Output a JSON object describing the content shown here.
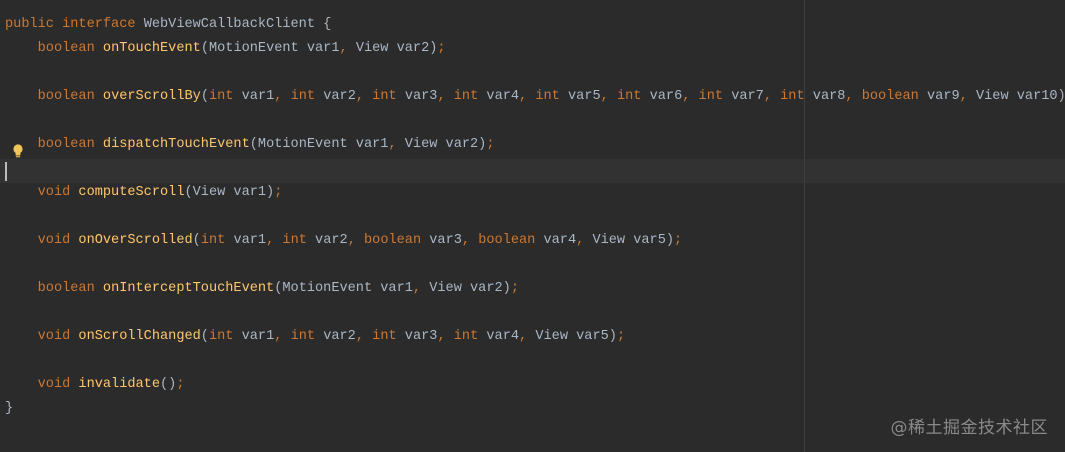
{
  "editor": {
    "language": "Java",
    "colors": {
      "background": "#2b2b2b",
      "keyword": "#cc7832",
      "method": "#ffc66d",
      "plain_text": "#a9b7c6",
      "current_line": "#323232"
    },
    "gutter_icon": "intention-bulb-icon",
    "lines": [
      [
        {
          "t": "public interface ",
          "c": "kw"
        },
        {
          "t": "WebViewCallbackClient {",
          "c": "plain"
        }
      ],
      [
        {
          "t": "    boolean ",
          "c": "kw"
        },
        {
          "t": "onTouchEvent",
          "c": "fn"
        },
        {
          "t": "(MotionEvent var1",
          "c": "plain"
        },
        {
          "t": ", ",
          "c": "punc"
        },
        {
          "t": "View var2)",
          "c": "plain"
        },
        {
          "t": ";",
          "c": "punc"
        }
      ],
      [],
      [
        {
          "t": "    boolean ",
          "c": "kw"
        },
        {
          "t": "overScrollBy",
          "c": "fn"
        },
        {
          "t": "(",
          "c": "plain"
        },
        {
          "t": "int ",
          "c": "kw"
        },
        {
          "t": "var1",
          "c": "plain"
        },
        {
          "t": ", int ",
          "c": "kw"
        },
        {
          "t": "var2",
          "c": "plain"
        },
        {
          "t": ", int ",
          "c": "kw"
        },
        {
          "t": "var3",
          "c": "plain"
        },
        {
          "t": ", int ",
          "c": "kw"
        },
        {
          "t": "var4",
          "c": "plain"
        },
        {
          "t": ", int ",
          "c": "kw"
        },
        {
          "t": "var5",
          "c": "plain"
        },
        {
          "t": ", int ",
          "c": "kw"
        },
        {
          "t": "var6",
          "c": "plain"
        },
        {
          "t": ", int ",
          "c": "kw"
        },
        {
          "t": "var7",
          "c": "plain"
        },
        {
          "t": ", int ",
          "c": "kw"
        },
        {
          "t": "var8",
          "c": "plain"
        },
        {
          "t": ", boolean ",
          "c": "kw"
        },
        {
          "t": "var9",
          "c": "plain"
        },
        {
          "t": ", ",
          "c": "punc"
        },
        {
          "t": "View var10)",
          "c": "plain"
        },
        {
          "t": ";",
          "c": "punc"
        }
      ],
      [],
      [
        {
          "t": "    boolean ",
          "c": "kw"
        },
        {
          "t": "dispatchTouchEvent",
          "c": "fn"
        },
        {
          "t": "(MotionEvent var1",
          "c": "plain"
        },
        {
          "t": ", ",
          "c": "punc"
        },
        {
          "t": "View var2)",
          "c": "plain"
        },
        {
          "t": ";",
          "c": "punc"
        }
      ],
      [],
      [
        {
          "t": "    void ",
          "c": "kw"
        },
        {
          "t": "computeScroll",
          "c": "fn"
        },
        {
          "t": "(View var1)",
          "c": "plain"
        },
        {
          "t": ";",
          "c": "punc"
        }
      ],
      [],
      [
        {
          "t": "    void ",
          "c": "kw"
        },
        {
          "t": "onOverScrolled",
          "c": "fn"
        },
        {
          "t": "(",
          "c": "plain"
        },
        {
          "t": "int ",
          "c": "kw"
        },
        {
          "t": "var1",
          "c": "plain"
        },
        {
          "t": ", int ",
          "c": "kw"
        },
        {
          "t": "var2",
          "c": "plain"
        },
        {
          "t": ", boolean ",
          "c": "kw"
        },
        {
          "t": "var3",
          "c": "plain"
        },
        {
          "t": ", boolean ",
          "c": "kw"
        },
        {
          "t": "var4",
          "c": "plain"
        },
        {
          "t": ", ",
          "c": "punc"
        },
        {
          "t": "View var5)",
          "c": "plain"
        },
        {
          "t": ";",
          "c": "punc"
        }
      ],
      [],
      [
        {
          "t": "    boolean ",
          "c": "kw"
        },
        {
          "t": "onInterceptTouchEvent",
          "c": "fn"
        },
        {
          "t": "(MotionEvent var1",
          "c": "plain"
        },
        {
          "t": ", ",
          "c": "punc"
        },
        {
          "t": "View var2)",
          "c": "plain"
        },
        {
          "t": ";",
          "c": "punc"
        }
      ],
      [],
      [
        {
          "t": "    void ",
          "c": "kw"
        },
        {
          "t": "onScrollChanged",
          "c": "fn"
        },
        {
          "t": "(",
          "c": "plain"
        },
        {
          "t": "int ",
          "c": "kw"
        },
        {
          "t": "var1",
          "c": "plain"
        },
        {
          "t": ", int ",
          "c": "kw"
        },
        {
          "t": "var2",
          "c": "plain"
        },
        {
          "t": ", int ",
          "c": "kw"
        },
        {
          "t": "var3",
          "c": "plain"
        },
        {
          "t": ", int ",
          "c": "kw"
        },
        {
          "t": "var4",
          "c": "plain"
        },
        {
          "t": ", ",
          "c": "punc"
        },
        {
          "t": "View var5)",
          "c": "plain"
        },
        {
          "t": ";",
          "c": "punc"
        }
      ],
      [],
      [
        {
          "t": "    void ",
          "c": "kw"
        },
        {
          "t": "invalidate",
          "c": "fn"
        },
        {
          "t": "()",
          "c": "plain"
        },
        {
          "t": ";",
          "c": "punc"
        }
      ],
      [
        {
          "t": "}",
          "c": "plain"
        }
      ]
    ]
  },
  "watermark": {
    "text": "@稀土掘金技术社区"
  }
}
